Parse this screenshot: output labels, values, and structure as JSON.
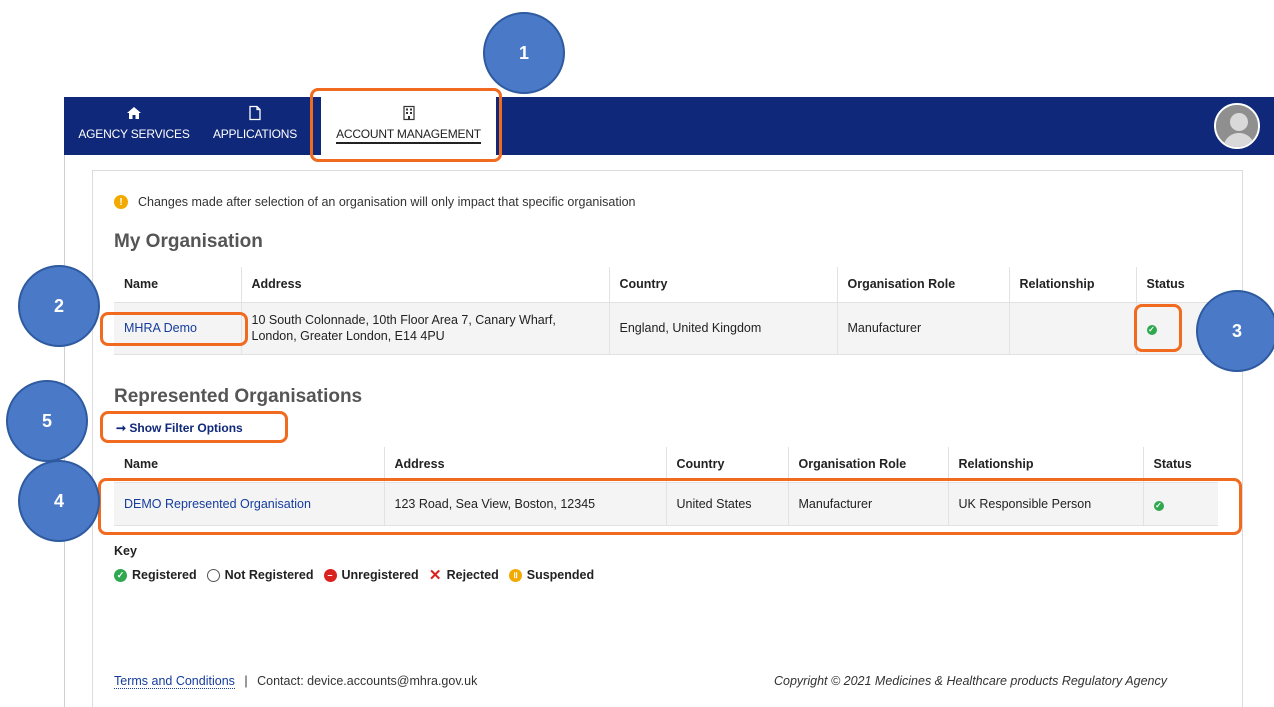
{
  "nav": {
    "items": [
      {
        "label": "AGENCY SERVICES",
        "icon": "home-icon"
      },
      {
        "label": "APPLICATIONS",
        "icon": "document-icon"
      },
      {
        "label": "ACCOUNT MANAGEMENT",
        "icon": "building-icon",
        "active": true
      }
    ]
  },
  "notice": {
    "text": "Changes made after selection of an organisation will only impact that specific organisation"
  },
  "my_org": {
    "title": "My Organisation",
    "headers": [
      "Name",
      "Address",
      "Country",
      "Organisation Role",
      "Relationship",
      "Status"
    ],
    "row": {
      "name": "MHRA Demo",
      "address_line1": "10 South Colonnade, 10th Floor Area 7, Canary Wharf,",
      "address_line2": "London, Greater London, E14 4PU",
      "country": "England, United Kingdom",
      "role": "Manufacturer",
      "relationship": "",
      "status": "Registered"
    }
  },
  "represented": {
    "title": "Represented Organisations",
    "filter_label": "➞ Show Filter Options",
    "headers": [
      "Name",
      "Address",
      "Country",
      "Organisation Role",
      "Relationship",
      "Status"
    ],
    "row": {
      "name": "DEMO Represented Organisation",
      "address": "123 Road, Sea View, Boston, 12345",
      "country": "United States",
      "role": "Manufacturer",
      "relationship": "UK Responsible Person",
      "status": "Registered"
    }
  },
  "key": {
    "title": "Key",
    "items": [
      "Registered",
      "Not Registered",
      "Unregistered",
      "Rejected",
      "Suspended"
    ]
  },
  "footer": {
    "terms": "Terms and Conditions",
    "separator": "|",
    "contact": "Contact: device.accounts@mhra.gov.uk",
    "copyright": "Copyright © 2021 Medicines & Healthcare products Regulatory Agency"
  },
  "callouts": [
    "1",
    "2",
    "3",
    "4",
    "5"
  ],
  "colors": {
    "nav_bg": "#0f2879",
    "callout_fill": "#4a79c7",
    "callout_box": "#f06a1f",
    "status_green": "#2fa84f"
  }
}
